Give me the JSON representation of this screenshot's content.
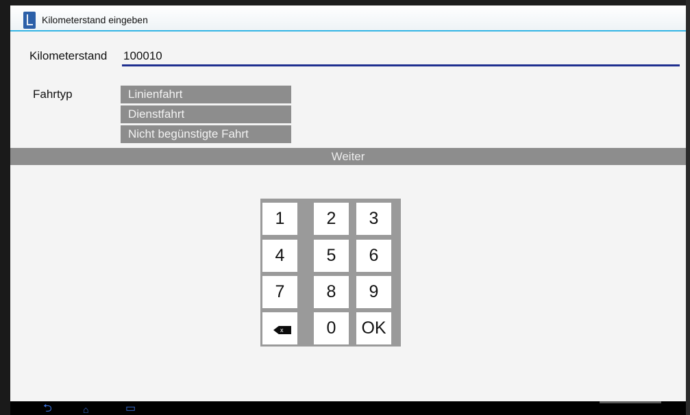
{
  "window": {
    "title": "Kilometerstand eingeben"
  },
  "form": {
    "km_label": "Kilometerstand",
    "km_value": "100010",
    "fahrtyp_label": "Fahrtyp",
    "fahrtyp_options": [
      "Linienfahrt",
      "Dienstfahrt",
      "Nicht begünstigte Fahrt"
    ],
    "next_label": "Weiter"
  },
  "keypad": {
    "keys": [
      "1",
      "2",
      "3",
      "4",
      "5",
      "6",
      "7",
      "8",
      "9",
      "0",
      "OK"
    ],
    "delete_icon": "backspace-icon",
    "delete_mark": "x"
  },
  "navbar": {
    "back_glyph": "⮌",
    "home_glyph": "⌂",
    "recent_glyph": "▭"
  },
  "colors": {
    "accent_blue": "#33b5e5",
    "field_underline": "#1f2f8f",
    "button_gray": "#8d8d8d",
    "keypad_gray": "#9a9a9a"
  }
}
